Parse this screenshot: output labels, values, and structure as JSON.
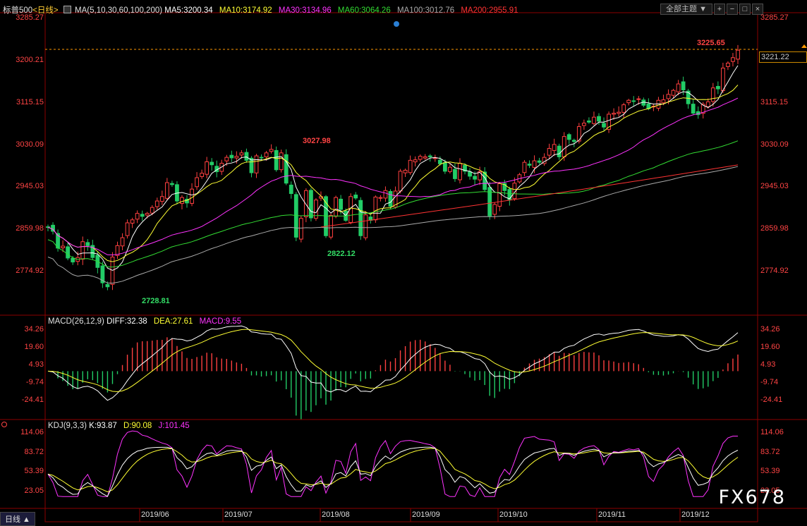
{
  "header": {
    "instrument": "标普500",
    "period_label": "<日线>",
    "ma_label": "MA(5,10,30,60,100,200)",
    "ma5": "MA5:3200.34",
    "ma10": "MA10:3174.92",
    "ma30": "MA30:3134.96",
    "ma60": "MA60:3064.26",
    "ma100": "MA100:3012.76",
    "ma200": "MA200:2955.91",
    "theme_button": "全部主题",
    "theme_arrow": "▼"
  },
  "macd_header": {
    "label": "MACD(26,12,9)",
    "diff": "DIFF:32.38",
    "dea": "DEA:27.61",
    "macd": "MACD:9.55"
  },
  "kdj_header": {
    "label": "KDJ(9,3,3)",
    "k": "K:93.87",
    "d": "D:90.08",
    "j": "J:101.45"
  },
  "price_axis": [
    "3285.27",
    "3200.21",
    "3115.15",
    "3030.09",
    "2945.03",
    "2859.98",
    "2774.92"
  ],
  "macd_axis": [
    "34.26",
    "19.60",
    "4.93",
    "-9.74",
    "-24.41"
  ],
  "kdj_axis": [
    "114.06",
    "83.72",
    "53.39",
    "23.05"
  ],
  "annotations": {
    "high_label": "3027.98",
    "low1_label": "2728.81",
    "low2_label": "2822.12",
    "top_label": "3225.65",
    "last_price": "3221.22"
  },
  "x_labels": [
    "2019/06",
    "2019/07",
    "2019/08",
    "2019/09",
    "2019/10",
    "2019/11",
    "2019/12"
  ],
  "period_tag": "日线",
  "watermark": "FX678",
  "colors": {
    "up": "#ff4040",
    "down": "#22cc66",
    "ma5": "#ffffff",
    "ma10": "#ffff33",
    "ma30": "#ff33ff",
    "ma60": "#33dd33",
    "ma100": "#aaaaaa",
    "ma200": "#ff3333",
    "axis_text": "#ff4444"
  },
  "chart_data": {
    "type": "candlestick",
    "x": [
      "2019/05/21",
      "2019/12/06"
    ],
    "ylim": [
      2700,
      3300
    ],
    "price_closes": [
      2864,
      2856,
      2822,
      2826,
      2802,
      2794,
      2803,
      2835,
      2827,
      2803,
      2783,
      2752,
      2744,
      2804,
      2827,
      2843,
      2873,
      2879,
      2892,
      2886,
      2892,
      2904,
      2917,
      2926,
      2954,
      2950,
      2917,
      2924,
      2913,
      2941,
      2964,
      2973,
      2996,
      2990,
      2976,
      2993,
      3005,
      3004,
      3007,
      3014,
      2999,
      2974,
      3008,
      3004,
      3014,
      3021,
      2980,
      3014,
      2953,
      2932,
      2844,
      2882,
      2938,
      2883,
      2919,
      2926,
      2847,
      2888,
      2924,
      2900,
      2878,
      2926,
      2923,
      2847,
      2889,
      2878,
      2925,
      2924,
      2938,
      2906,
      2937,
      2977,
      2979,
      2999,
      3000,
      3007,
      3006,
      3006,
      3004,
      2992,
      2977,
      2985,
      2962,
      2993,
      2977,
      2967,
      2961,
      2976,
      2940,
      2887,
      2910,
      2952,
      2938,
      2919,
      2953,
      2970,
      2995,
      2989,
      2998,
      2995,
      3005,
      3023,
      3031,
      3006,
      3047,
      3041,
      3037,
      3067,
      3074,
      3076,
      3086,
      3078,
      3066,
      3092,
      3094,
      3096,
      3111,
      3120,
      3118,
      3123,
      3110,
      3103,
      3108,
      3120,
      3121,
      3132,
      3140,
      3153,
      3141,
      3113,
      3094,
      3091,
      3112,
      3117,
      3145,
      3143,
      3185,
      3195,
      3206,
      3221
    ],
    "macd": {
      "diff_last": 32.38,
      "dea_last": 27.61,
      "macd_last": 9.55,
      "ylim": [
        -30,
        40
      ]
    },
    "kdj": {
      "k_last": 93.87,
      "d_last": 90.08,
      "j_last": 101.45,
      "ylim": [
        10,
        120
      ]
    }
  }
}
